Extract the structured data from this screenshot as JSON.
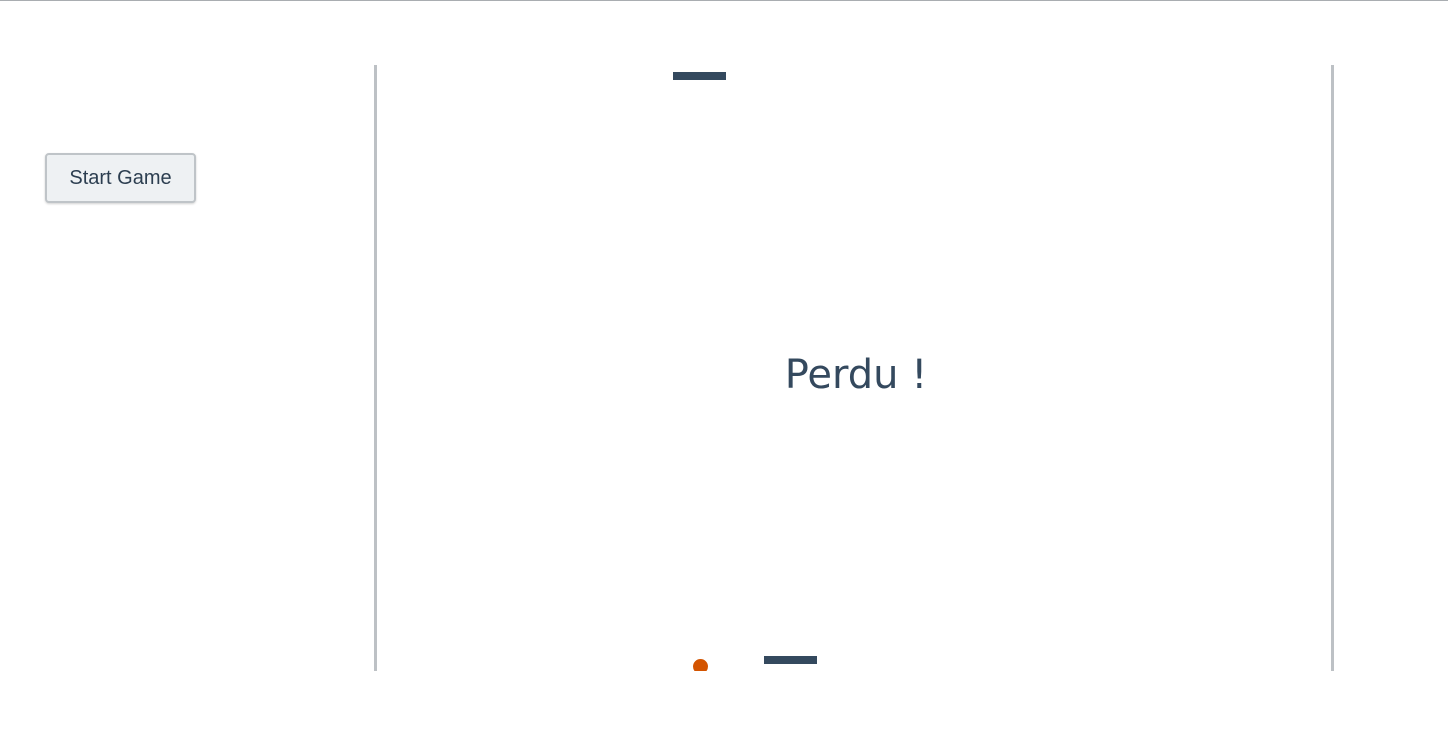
{
  "controls": {
    "start_label": "Start Game"
  },
  "game": {
    "message": "Perdu !",
    "colors": {
      "paddle": "#34495e",
      "ball": "#d35400",
      "wall": "#bdc1c5",
      "text": "#34495e"
    }
  }
}
